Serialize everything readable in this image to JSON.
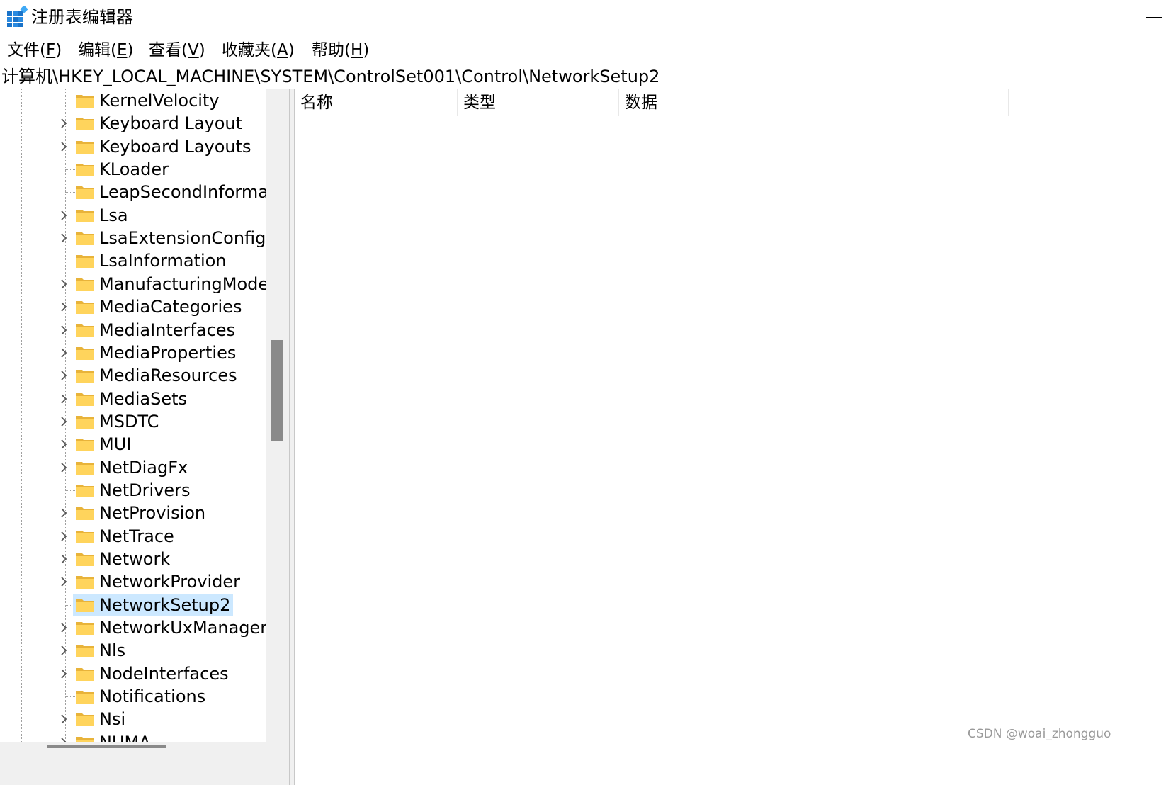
{
  "window": {
    "title": "注册表编辑器"
  },
  "menu": [
    {
      "label": "文件(",
      "key": "F",
      "close": ")"
    },
    {
      "label": "编辑(",
      "key": "E",
      "close": ")"
    },
    {
      "label": "查看(",
      "key": "V",
      "close": ")"
    },
    {
      "label": "收藏夹(",
      "key": "A",
      "close": ")"
    },
    {
      "label": "帮助(",
      "key": "H",
      "close": ")"
    }
  ],
  "address": {
    "path": "计算机\\HKEY_LOCAL_MACHINE\\SYSTEM\\ControlSet001\\Control\\NetworkSetup2"
  },
  "tree": {
    "nodes": [
      {
        "label": "KernelVelocity",
        "expandable": false
      },
      {
        "label": "Keyboard Layout",
        "expandable": true
      },
      {
        "label": "Keyboard Layouts",
        "expandable": true
      },
      {
        "label": "KLoader",
        "expandable": false
      },
      {
        "label": "LeapSecondInformation",
        "expandable": false
      },
      {
        "label": "Lsa",
        "expandable": true
      },
      {
        "label": "LsaExtensionConfig",
        "expandable": true
      },
      {
        "label": "LsaInformation",
        "expandable": false
      },
      {
        "label": "ManufacturingMode",
        "expandable": true
      },
      {
        "label": "MediaCategories",
        "expandable": true
      },
      {
        "label": "MediaInterfaces",
        "expandable": true
      },
      {
        "label": "MediaProperties",
        "expandable": true
      },
      {
        "label": "MediaResources",
        "expandable": true
      },
      {
        "label": "MediaSets",
        "expandable": true
      },
      {
        "label": "MSDTC",
        "expandable": true
      },
      {
        "label": "MUI",
        "expandable": true
      },
      {
        "label": "NetDiagFx",
        "expandable": true
      },
      {
        "label": "NetDrivers",
        "expandable": false
      },
      {
        "label": "NetProvision",
        "expandable": true
      },
      {
        "label": "NetTrace",
        "expandable": true
      },
      {
        "label": "Network",
        "expandable": true
      },
      {
        "label": "NetworkProvider",
        "expandable": true
      },
      {
        "label": "NetworkSetup2",
        "expandable": false,
        "selected": true
      },
      {
        "label": "NetworkUxManager",
        "expandable": true
      },
      {
        "label": "Nls",
        "expandable": true
      },
      {
        "label": "NodeInterfaces",
        "expandable": true
      },
      {
        "label": "Notifications",
        "expandable": false
      },
      {
        "label": "Nsi",
        "expandable": true
      },
      {
        "label": "NUMA",
        "expandable": true
      }
    ]
  },
  "list": {
    "columns": [
      "名称",
      "类型",
      "数据"
    ]
  },
  "watermark": "CSDN @woai_zhongguo",
  "colors": {
    "selection": "#cce8ff",
    "folder": "#ffd45c",
    "folder_dark": "#e8b33a",
    "scroll_thumb": "#8a8a8a"
  }
}
